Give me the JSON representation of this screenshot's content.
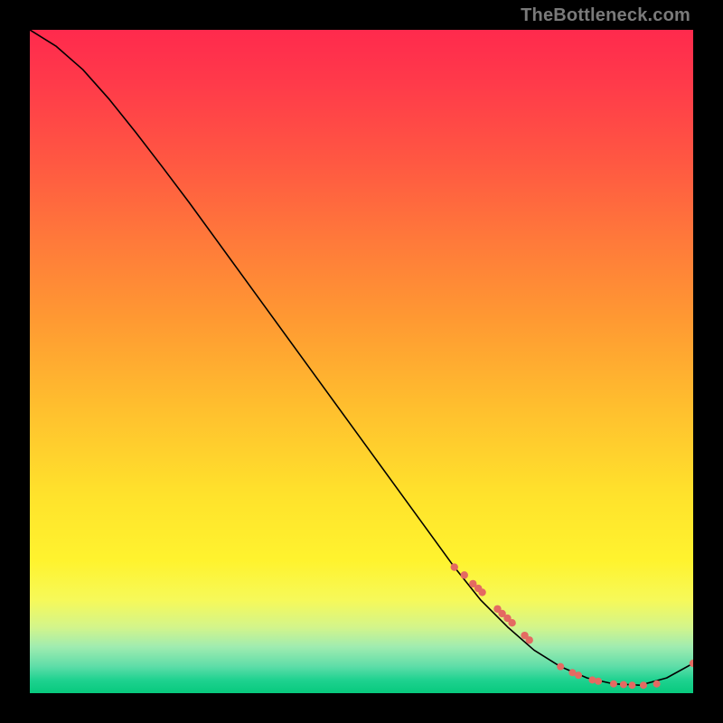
{
  "watermark": "TheBottleneck.com",
  "chart_data": {
    "type": "line",
    "title": "",
    "xlabel": "",
    "ylabel": "",
    "xlim": [
      0,
      100
    ],
    "ylim": [
      0,
      100
    ],
    "grid": false,
    "series": [
      {
        "name": "bottleneck-curve",
        "color": "#000000",
        "x": [
          0,
          4,
          8,
          12,
          16,
          20,
          24,
          28,
          32,
          36,
          40,
          44,
          48,
          52,
          56,
          60,
          64,
          68,
          72,
          76,
          80,
          84,
          88,
          92,
          96,
          100
        ],
        "y": [
          100,
          97.5,
          94,
          89.5,
          84.5,
          79.3,
          74,
          68.5,
          63,
          57.5,
          52,
          46.5,
          41,
          35.5,
          30,
          24.5,
          19,
          14,
          10,
          6.5,
          4,
          2.3,
          1.4,
          1.2,
          2.3,
          4.5
        ]
      }
    ],
    "highlight_points": {
      "name": "highlight-dots",
      "color": "#e46a62",
      "x": [
        64,
        65.5,
        66.8,
        67.6,
        68.2,
        70.5,
        71.2,
        72.0,
        72.7,
        74.6,
        75.3,
        80.0,
        81.8,
        82.7,
        84.8,
        85.7,
        88.0,
        89.5,
        90.8,
        92.5,
        94.5,
        100
      ],
      "y": [
        19.0,
        17.8,
        16.5,
        15.8,
        15.2,
        12.7,
        12.0,
        11.3,
        10.6,
        8.7,
        8.0,
        4.0,
        3.1,
        2.7,
        2.0,
        1.8,
        1.4,
        1.3,
        1.2,
        1.2,
        1.4,
        4.5
      ],
      "radius": [
        4.2,
        4.2,
        4.2,
        4.2,
        4.2,
        4.2,
        4.2,
        4.2,
        4.2,
        4.2,
        4.2,
        4.0,
        4.0,
        4.0,
        4.0,
        4.0,
        4.0,
        4.0,
        4.0,
        4.0,
        4.0,
        4.2
      ]
    }
  }
}
